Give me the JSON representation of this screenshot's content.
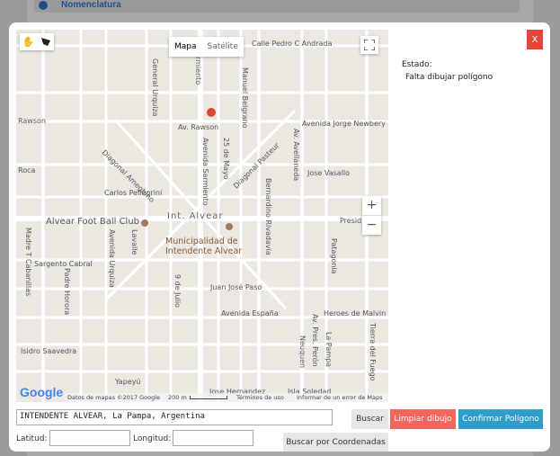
{
  "background": {
    "section_title": "Nomenclatura"
  },
  "map": {
    "type_buttons": [
      "Mapa",
      "Satélite"
    ],
    "zoom_in": "+",
    "zoom_out": "−",
    "streets": {
      "calle_pedro": "Calle Pedro C Andrada",
      "rawson": "Rawson",
      "av_rawson": "Av. Rawson",
      "av_jorge": "Avenida Jorge Newbery",
      "roca": "Roca",
      "jose_vasallo": "Jose Vasallo",
      "carlos": "Carlos Pellegrini",
      "alvear_club": "Alvear Foot Ball Club",
      "int_alvear": "Int. Alvear",
      "presid": "Presid",
      "muni": "Municipalidad de",
      "muni2": "Intendente Alvear",
      "sargento": "Sargento Cabral",
      "juan_jose": "Juan José Paso",
      "av_espana": "Avenida España",
      "heroes": "Heroes de Malvin",
      "rivadavia": "Isidro Saavedra",
      "yapeyu": "Yapeyú",
      "jose_hernandez": "Jose Hernandez",
      "isla": "Isla Soledad",
      "gral_urquiza": "General Urquiza",
      "sarmiento": "Sarmiento",
      "belgrano": "Manuel Belgrano",
      "diag_ameghino": "Diagonal Ameghino",
      "av_sarmiento": "Avenida Sarmiento",
      "25mayo": "25 de Mayo",
      "diag_pasteur": "Diagonal Pasteur",
      "bernardino": "Bernardino Rivadavia",
      "av_avellaneda": "Av. Avellaneda",
      "madre": "Madre T Cabanillas",
      "padre": "Padre Horora",
      "av_urquiza": "Avenida Urquiza",
      "lavalle": "Lavalle",
      "9julio": "9 de Julio",
      "patagonia": "Patagonia",
      "pres_peron": "Av. Pres. Perón",
      "la_pampa": "La Pampa",
      "neuquen": "Neuquen",
      "tierra": "Tierra del Fuego"
    },
    "footer": {
      "data": "Datos de mapas ©2017 Google",
      "scale": "200 m",
      "terms": "Términos de uso",
      "report": "Informar de un error de Maps"
    },
    "logo": "Google"
  },
  "close_label": "X",
  "status": {
    "label": "Estado:",
    "value": "Falta dibujar polígono"
  },
  "search": {
    "address_value": "INTENDENTE ALVEAR, La Pampa, Argentina",
    "search_label": "Buscar",
    "clear_label": "Limpiar dibujo",
    "confirm_label": "Confirmar Polígono"
  },
  "coords": {
    "lat_label": "Latitud:",
    "lon_label": "Longitud:",
    "lat_value": "",
    "lon_value": "",
    "search_coords_label": "Buscar por Coordenadas"
  },
  "colors": {
    "close": "#e84437",
    "clear": "#f0675e",
    "confirm": "#2f9cc9",
    "search": "#e6e6e6"
  }
}
